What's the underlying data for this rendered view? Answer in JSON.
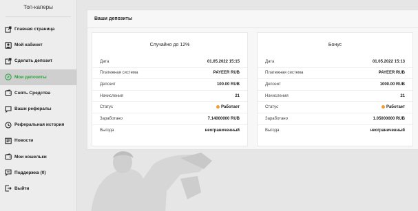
{
  "sidebar": {
    "title": "Топ-каперы",
    "items": [
      {
        "label": "Главная страница",
        "icon": "external-link-icon",
        "active": false
      },
      {
        "label": "Мой кабинет",
        "icon": "user-icon",
        "active": false
      },
      {
        "label": "Сделать депозит",
        "icon": "external-link-icon",
        "active": false
      },
      {
        "label": "Мои депозиты",
        "icon": "money-circle-icon",
        "active": true
      },
      {
        "label": "Снять Средства",
        "icon": "wallet-icon",
        "active": false
      },
      {
        "label": "Ваши рефералы",
        "icon": "chat-icon",
        "active": false
      },
      {
        "label": "Реферальная история",
        "icon": "history-icon",
        "active": false
      },
      {
        "label": "Новости",
        "icon": "news-icon",
        "active": false
      },
      {
        "label": "Мои кошельки",
        "icon": "wallet-icon",
        "active": false
      },
      {
        "label": "Поддержка (0)",
        "icon": "support-icon",
        "active": false
      },
      {
        "label": "Выйти",
        "icon": "logout-icon",
        "active": false
      }
    ]
  },
  "colors": {
    "active_green": "#2aa63a",
    "status_orange": "#f0a030"
  },
  "panel": {
    "title": "Ваши депозиты"
  },
  "deposits": [
    {
      "plan": "Случайно до 12%",
      "rows": [
        {
          "label": "Дата",
          "value": "01.05.2022 15:15"
        },
        {
          "label": "Платежная система",
          "value": "PAYEER RUB"
        },
        {
          "label": "Депозит",
          "value": "100.00 RUB"
        },
        {
          "label": "Начисления",
          "value": "21"
        },
        {
          "label": "Статус",
          "value": "Работает",
          "status": true
        },
        {
          "label": "Заработано",
          "value": "7.14000000 RUB"
        },
        {
          "label": "Выгода",
          "value": "неограниченный"
        }
      ]
    },
    {
      "plan": "Бонус",
      "rows": [
        {
          "label": "Дата",
          "value": "01.05.2022 15:13"
        },
        {
          "label": "Платежная система",
          "value": "PAYEER RUB"
        },
        {
          "label": "Депозит",
          "value": "1000.00 RUB"
        },
        {
          "label": "Начисления",
          "value": "21"
        },
        {
          "label": "Статус",
          "value": "Работает",
          "status": true
        },
        {
          "label": "Заработано",
          "value": "1.05000000 RUB"
        },
        {
          "label": "Выгода",
          "value": "неограниченный"
        }
      ]
    }
  ]
}
